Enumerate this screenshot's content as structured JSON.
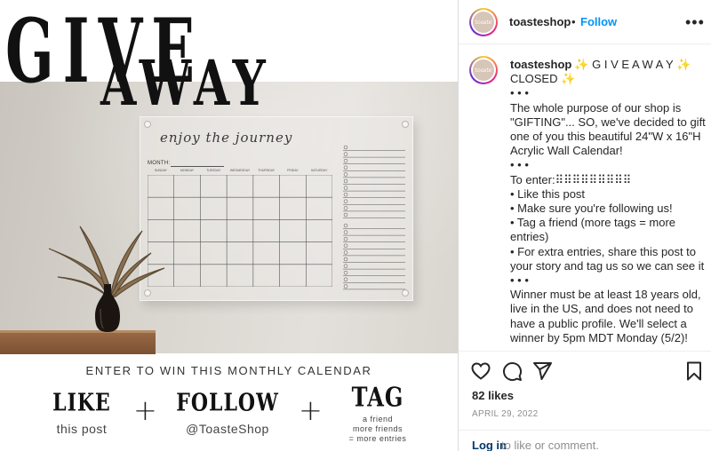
{
  "post": {
    "giveaway_word_1": "GIVE",
    "giveaway_word_2": "AWAY",
    "calendar": {
      "heading": "enjoy the journey",
      "month_label": "MONTH:",
      "days": [
        "SUNDAY",
        "MONDAY",
        "TUESDAY",
        "WEDNESDAY",
        "THURSDAY",
        "FRIDAY",
        "SATURDAY"
      ]
    },
    "enter_text": "ENTER TO WIN THIS MONTHLY CALENDAR",
    "promo": {
      "like_title": "LIKE",
      "like_sub": "this post",
      "plus": "+",
      "follow_title": "FOLLOW",
      "follow_sub": "@ToasteShop",
      "tag_title": "TAG",
      "tag_sub_1": "a friend",
      "tag_sub_2": "more friends",
      "tag_sub_3": "= more entries"
    }
  },
  "header": {
    "avatar_text": "toaste",
    "username": "toasteshop",
    "dot": "•",
    "follow_label": "Follow",
    "more_icon": "•••"
  },
  "caption": {
    "username": "toasteshop",
    "lines": [
      "✨ G I V E A W A Y ✨",
      "CLOSED ✨",
      "• • •",
      "The whole purpose of our shop is \"GIFTING\"... SO, we've decided to gift one of you this beautiful 24\"W x 16\"H Acrylic Wall Calendar!",
      "• • •",
      "To enter:⠿⠿⠿⠿⠿⠿⠿⠿⠿",
      "• Like this post",
      "• Make sure you're following us!",
      "• Tag a friend (more tags = more entries)",
      "• For extra entries, share this post to your story and tag us so we can see it",
      "• • •",
      "Winner must be at least 18 years old, live in the US, and does not need to have a public profile. We'll select a winner by 5pm MDT Monday (5/2)!"
    ]
  },
  "actions": {
    "icons": [
      "heart-icon",
      "comment-icon",
      "share-icon",
      "bookmark-icon"
    ],
    "likes": "82 likes",
    "date": "APRIL 29, 2022"
  },
  "footer": {
    "login_label": "Log in",
    "login_rest": "to like or comment."
  },
  "colors": {
    "link_blue": "#0095f6",
    "text": "#262626",
    "muted": "#8e8e8e",
    "login_link": "#00376b"
  }
}
